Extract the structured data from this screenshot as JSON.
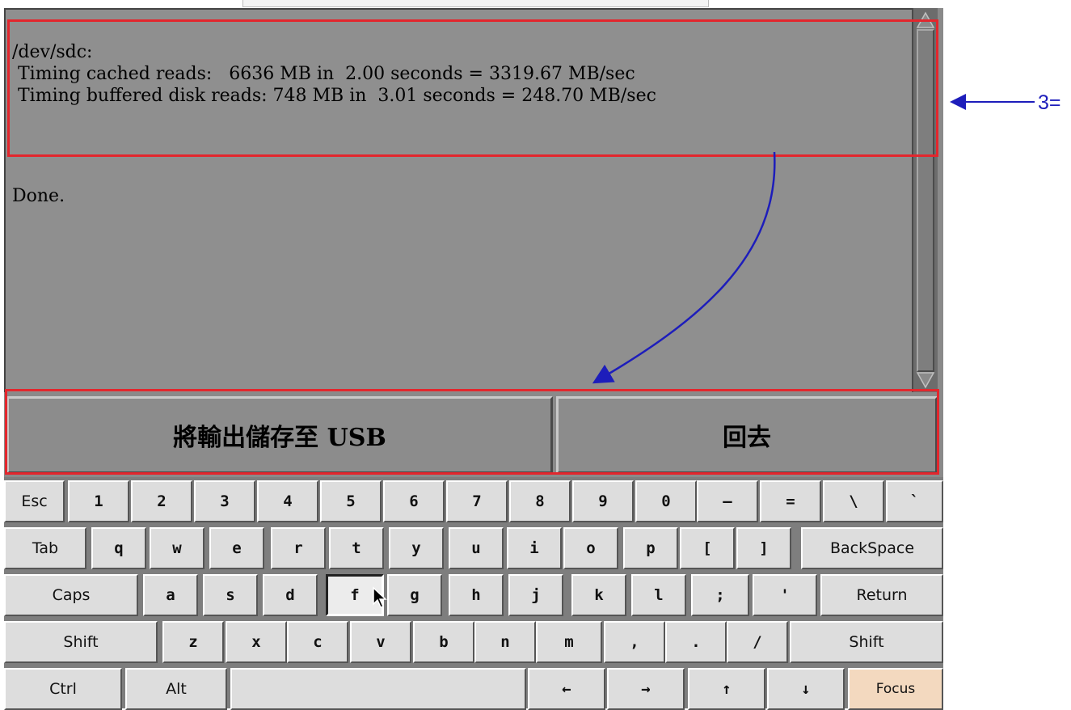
{
  "terminal": {
    "lines": [
      "/dev/sdc:",
      " Timing cached reads:   6636 MB in  2.00 seconds = 3319.67 MB/sec",
      " Timing buffered disk reads: 748 MB in  3.01 seconds = 248.70 MB/sec",
      "Done."
    ]
  },
  "actions": {
    "save_usb": "將輸出儲存至 USB",
    "back": "回去"
  },
  "annotation": {
    "label": "3=",
    "arrow_color": "#1d1dbb",
    "highlight_color": "#e3262d"
  },
  "keyboard": {
    "rows": [
      [
        "Esc",
        "1",
        "2",
        "3",
        "4",
        "5",
        "6",
        "7",
        "8",
        "9",
        "0",
        "–",
        "=",
        "\\",
        "`"
      ],
      [
        "Tab",
        "q",
        "w",
        "e",
        "r",
        "t",
        "y",
        "u",
        "i",
        "o",
        "p",
        "[",
        "]",
        "BackSpace"
      ],
      [
        "Caps",
        "a",
        "s",
        "d",
        "f",
        "g",
        "h",
        "j",
        "k",
        "l",
        ";",
        "'",
        "Return"
      ],
      [
        "Shift",
        "z",
        "x",
        "c",
        "v",
        "b",
        "n",
        "m",
        ",",
        ".",
        "/",
        "Shift"
      ],
      [
        "Ctrl",
        "Alt",
        "",
        "←",
        "→",
        "↑",
        "↓",
        "Focus"
      ]
    ],
    "focus_key_color": "#f3d9bf",
    "pressed_key": "f"
  }
}
